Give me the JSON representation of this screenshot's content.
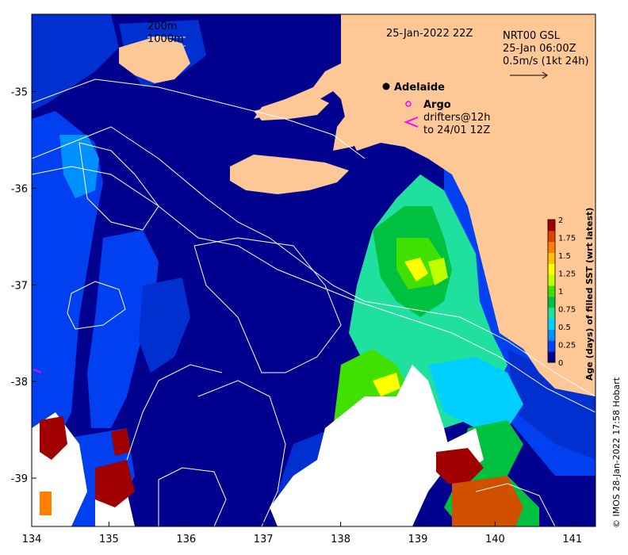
{
  "map": {
    "date_label": "25-Jan-2022 22Z",
    "depth_contours": [
      "200m",
      "1000m"
    ],
    "current_info": [
      "NRT00 GSL",
      "25-Jan 06:00Z",
      "0.5m/s (1kt 24h)"
    ],
    "city": "Adelaide",
    "legend_argo": "Argo",
    "legend_drifters": [
      "drifters@12h",
      "to 24/01 12Z"
    ],
    "credit": "© IMOS 28-Jan-2022 17:58 Hobart",
    "colors": {
      "ocean_deep": "#00008f",
      "land": "#fdc896",
      "no_data": "#ffffff",
      "contour": "#ffffff",
      "argo": "#ff00ff",
      "drifter": "#ff00ff"
    }
  },
  "chart_data": {
    "type": "heatmap",
    "x_ticks": [
      "134",
      "135",
      "136",
      "137",
      "138",
      "139",
      "140",
      "141"
    ],
    "y_ticks": [
      "-35",
      "-36",
      "-37",
      "-38",
      "-39"
    ],
    "xlim": [
      134,
      141.3
    ],
    "ylim": [
      -39.5,
      -34.2
    ],
    "colorbar": {
      "title": "Age (days) of filled SST (wrt latest)",
      "ticks": [
        "0",
        "0.25",
        "0.5",
        "0.75",
        "1",
        "1.25",
        "1.5",
        "1.75",
        "2"
      ],
      "range": [
        0,
        2
      ],
      "colors": [
        "#00008f",
        "#0040ff",
        "#0090ff",
        "#00d0ff",
        "#20e0a0",
        "#00c040",
        "#40e000",
        "#c0ff00",
        "#ffff00",
        "#ffc000",
        "#ff8000",
        "#e04000",
        "#a00000"
      ]
    }
  }
}
